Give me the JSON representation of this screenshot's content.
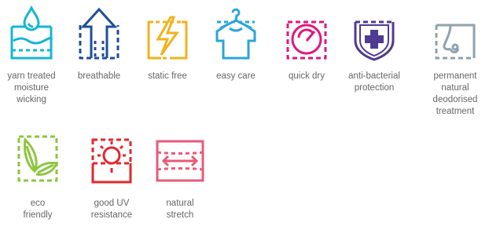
{
  "features": [
    {
      "id": "yarn",
      "icon": "water-drop-moisture-icon",
      "color": "#16b5d5",
      "label": "yarn treated\nmoisture\nwicking"
    },
    {
      "id": "breathable",
      "icon": "breathable-arrow-up-icon",
      "color": "#1f4e9a",
      "label": "breathable"
    },
    {
      "id": "static",
      "icon": "lightning-bolt-icon",
      "color": "#f2b21c",
      "label": "static free"
    },
    {
      "id": "easycare",
      "icon": "shirt-hanger-icon",
      "color": "#2aa4dc",
      "label": "easy care"
    },
    {
      "id": "quickdry",
      "icon": "gauge-speedometer-icon",
      "color": "#e0187f",
      "label": "quick dry"
    },
    {
      "id": "antibact",
      "icon": "shield-cross-icon",
      "color": "#4f3a93",
      "label": "anti-bacterial\nprotection"
    },
    {
      "id": "deodor",
      "icon": "nose-profile-icon",
      "color": "#8fa2ac",
      "label": "permanent\nnatural\ndeodorised\ntreatment"
    },
    {
      "id": "eco",
      "icon": "leaf-icon",
      "color": "#8cc63f",
      "label": "eco\nfriendly"
    },
    {
      "id": "uv",
      "icon": "sun-uv-icon",
      "color": "#e2272e",
      "label": "good UV\nresistance"
    },
    {
      "id": "stretch",
      "icon": "stretch-arrows-icon",
      "color": "#e95a78",
      "label": "natural\nstretch"
    }
  ]
}
